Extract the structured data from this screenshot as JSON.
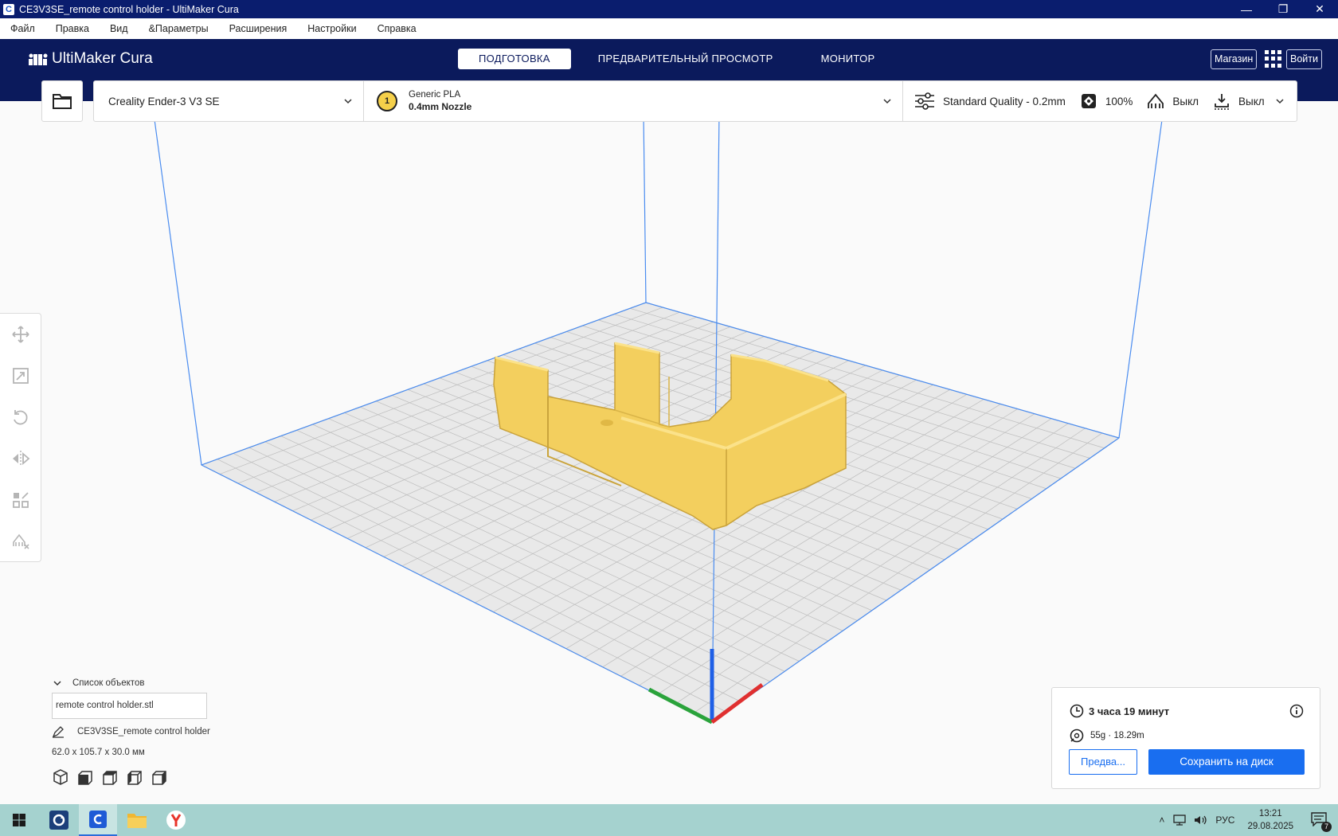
{
  "window": {
    "title": "CE3V3SE_remote control holder - UltiMaker Cura",
    "minimize": "—",
    "restore": "❐",
    "close": "✕"
  },
  "menu": [
    "Файл",
    "Правка",
    "Вид",
    "&Параметры",
    "Расширения",
    "Настройки",
    "Справка"
  ],
  "header": {
    "logo": "UltiMaker Cura",
    "tabs": [
      {
        "label": "ПОДГОТОВКА",
        "active": true
      },
      {
        "label": "ПРЕДВАРИТЕЛЬНЫЙ ПРОСМОТР",
        "active": false
      },
      {
        "label": "МОНИТОР",
        "active": false
      }
    ],
    "marketplace": "Магазин",
    "signin": "Войти"
  },
  "toolbar": {
    "printer": "Creality Ender-3 V3 SE",
    "extruder_number": "1",
    "material": "Generic PLA",
    "nozzle": "0.4mm Nozzle",
    "quality": "Standard Quality - 0.2mm",
    "infill": "100%",
    "support": "Выкл",
    "adhesion": "Выкл"
  },
  "object_list": {
    "heading": "Список объектов",
    "file": "remote control holder.stl",
    "project": "CE3V3SE_remote control holder",
    "dimensions": "62.0 x 105.7 x 30.0 мм"
  },
  "print_panel": {
    "time": "3 часа 19 минут",
    "material_usage": "55g · 18.29m",
    "preview": "Предва...",
    "save": "Сохранить на диск"
  },
  "taskbar": {
    "language": "РУС",
    "time": "13:21",
    "date": "29.08.2025",
    "notifications": "7"
  },
  "colors": {
    "header": "#0b1a5c",
    "accent": "#196ef0",
    "model": "#f3cf5e"
  }
}
